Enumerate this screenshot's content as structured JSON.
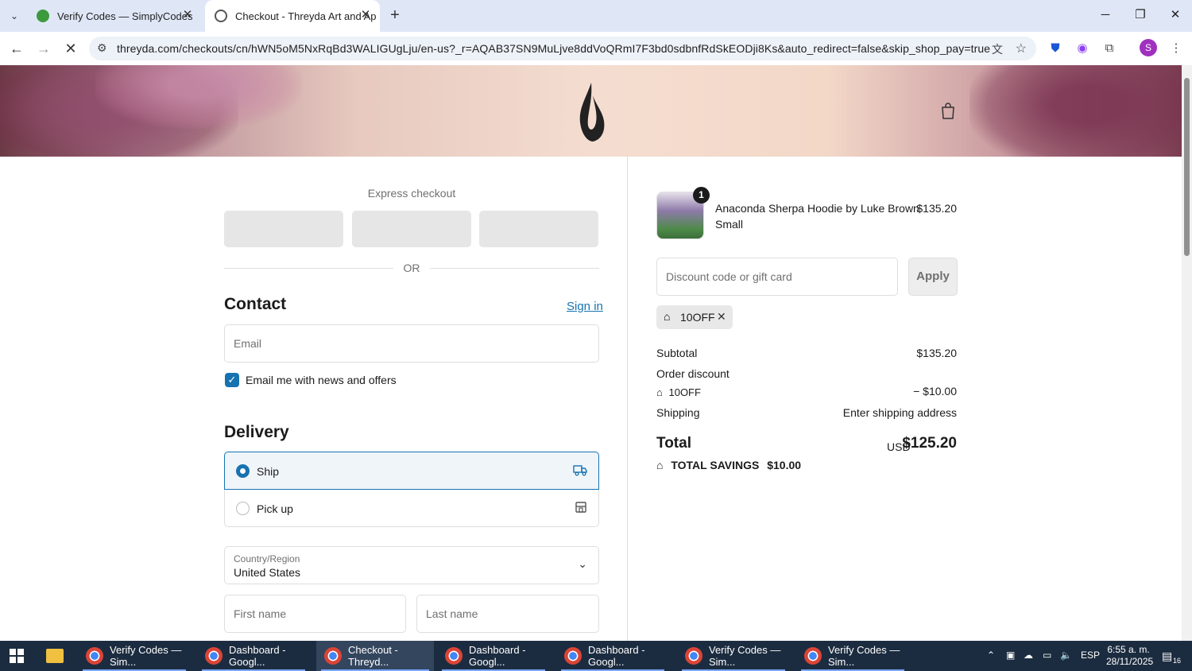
{
  "browser": {
    "tabs": [
      {
        "title": "Verify Codes — SimplyCodes",
        "close": "✕"
      },
      {
        "title": "Checkout - Threyda Art and Ap",
        "close": "✕"
      }
    ],
    "new_tab": "+",
    "url": "threyda.com/checkouts/cn/hWN5oM5NxRqBd3WALIGUgLju/en-us?_r=AQAB37SN9MuLjve8ddVoQRmI7F3bd0sdbnfRdSkEODji8Ks&auto_redirect=false&skip_shop_pay=true",
    "profile_initial": "S"
  },
  "checkout": {
    "express_title": "Express checkout",
    "or_label": "OR",
    "contact_heading": "Contact",
    "sign_in": "Sign in",
    "email_placeholder": "Email",
    "email_news_label": "Email me with news and offers",
    "delivery_heading": "Delivery",
    "ship_label": "Ship",
    "pickup_label": "Pick up",
    "country_label": "Country/Region",
    "country_value": "United States",
    "first_name_placeholder": "First name",
    "last_name_placeholder": "Last name"
  },
  "summary": {
    "quantity": "1",
    "product_name": "Anaconda Sherpa Hoodie by Luke Brown",
    "variant": "Small",
    "product_price": "$135.20",
    "discount_placeholder": "Discount code or gift card",
    "apply_label": "Apply",
    "applied_code": "10OFF",
    "subtotal_label": "Subtotal",
    "subtotal_value": "$135.20",
    "order_discount_label": "Order discount",
    "discount_code": "10OFF",
    "discount_value": "− $10.00",
    "shipping_label": "Shipping",
    "shipping_value": "Enter shipping address",
    "total_label": "Total",
    "currency": "USD",
    "total_value": "$125.20",
    "savings_label": "TOTAL SAVINGS",
    "savings_value": "$10.00"
  },
  "taskbar": {
    "apps": [
      {
        "label": "Verify Codes — Sim..."
      },
      {
        "label": "Dashboard - Googl..."
      },
      {
        "label": "Checkout - Threyd..."
      },
      {
        "label": "Dashboard - Googl..."
      },
      {
        "label": "Dashboard - Googl..."
      },
      {
        "label": "Verify Codes — Sim..."
      },
      {
        "label": "Verify Codes — Sim..."
      }
    ],
    "language": "ESP",
    "time": "6:55 a. m.",
    "date": "28/11/2025",
    "notification_count": "16"
  },
  "colors": {
    "accent": "#1773b0",
    "taskbar": "#1c2c40"
  }
}
